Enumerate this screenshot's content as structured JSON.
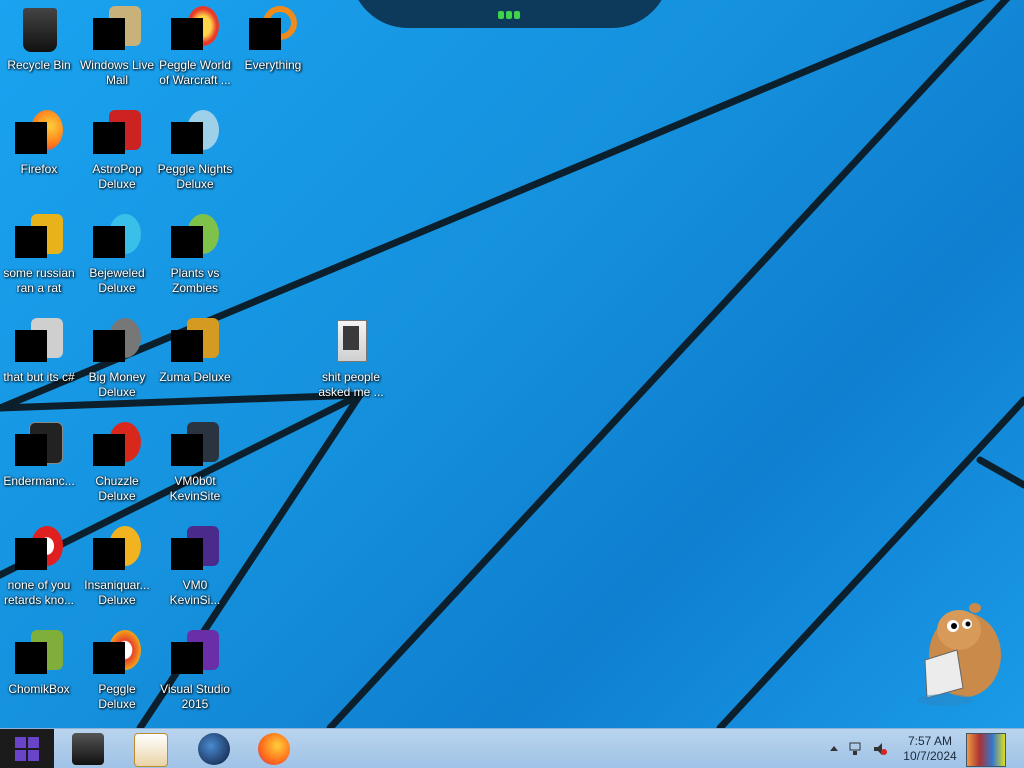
{
  "desktop_icons": [
    {
      "label": "Recycle Bin",
      "icon": "recycle-bin-icon"
    },
    {
      "label": "Windows Live Mail",
      "icon": "mail-icon"
    },
    {
      "label": "Peggle World of Warcraft ...",
      "icon": "peggle-wow-icon"
    },
    {
      "label": "Everything",
      "icon": "search-everything-icon"
    },
    {
      "label": "Firefox",
      "icon": "firefox-icon"
    },
    {
      "label": "AstroPop Deluxe",
      "icon": "astropop-icon"
    },
    {
      "label": "Peggle Nights Deluxe",
      "icon": "peggle-nights-icon"
    },
    {
      "label": "some russian ran a rat",
      "icon": "shortcut-icon"
    },
    {
      "label": "Bejeweled Deluxe",
      "icon": "bejeweled-icon"
    },
    {
      "label": "Plants vs Zombies",
      "icon": "pvz-icon"
    },
    {
      "label": "that but its c#",
      "icon": "shortcut-icon"
    },
    {
      "label": "Big Money Deluxe",
      "icon": "big-money-icon"
    },
    {
      "label": "Zuma Deluxe",
      "icon": "zuma-icon"
    },
    {
      "label": "shit people asked me ...",
      "icon": "folder-icon"
    },
    {
      "label": "Endermanc...",
      "icon": "app-icon"
    },
    {
      "label": "Chuzzle Deluxe",
      "icon": "chuzzle-icon"
    },
    {
      "label": "VM0b0t KevinSite",
      "icon": "vm-icon"
    },
    {
      "label": "none of you retards kno...",
      "icon": "shortcut-icon"
    },
    {
      "label": "Insaniquar... Deluxe",
      "icon": "insaniquarium-icon"
    },
    {
      "label": "VM0 KevinSi...",
      "icon": "vm-icon"
    },
    {
      "label": "ChomikBox",
      "icon": "chomikbox-icon"
    },
    {
      "label": "Peggle Deluxe",
      "icon": "peggle-icon"
    },
    {
      "label": "Visual Studio 2015",
      "icon": "visual-studio-icon"
    }
  ],
  "taskbar": {
    "pinned": [
      "terminal-icon",
      "media-player-icon",
      "globe-icon",
      "firefox-icon"
    ],
    "clock_time": "7:57 AM",
    "clock_date": "10/7/2024"
  },
  "colors": {
    "wallpaper": "#1590dc",
    "taskbar": "#a9c9ea",
    "start": "#1b1b1b"
  }
}
